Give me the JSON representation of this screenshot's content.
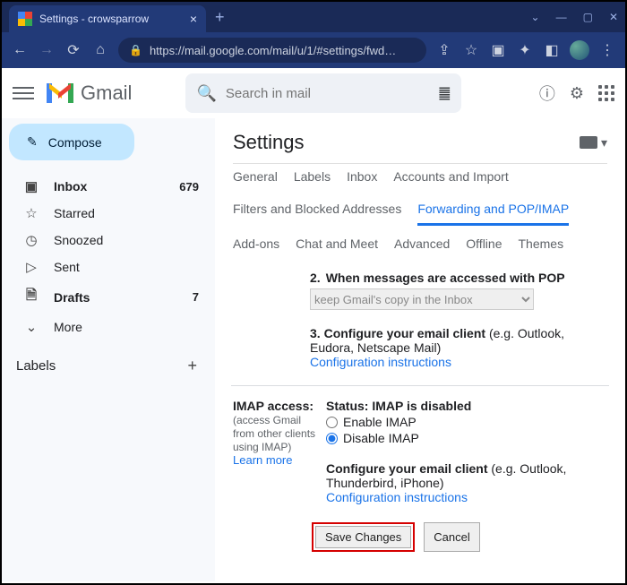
{
  "browser": {
    "tab_title": "Settings - crowsparrow",
    "url_display": "https://mail.google.com/mail/u/1/#settings/fwd…"
  },
  "brand": "Gmail",
  "search": {
    "placeholder": "Search in mail"
  },
  "compose_label": "Compose",
  "nav": {
    "inbox": "Inbox",
    "inbox_count": "679",
    "starred": "Starred",
    "snoozed": "Snoozed",
    "sent": "Sent",
    "drafts": "Drafts",
    "drafts_count": "7",
    "more": "More"
  },
  "labels_header": "Labels",
  "settings": {
    "title": "Settings",
    "tabs": {
      "general": "General",
      "labels": "Labels",
      "inbox": "Inbox",
      "accounts": "Accounts and Import",
      "filters": "Filters and Blocked Addresses",
      "fwd": "Forwarding and POP/IMAP",
      "addons": "Add-ons",
      "chat": "Chat and Meet",
      "advanced": "Advanced",
      "offline": "Offline",
      "themes": "Themes"
    },
    "pop": {
      "step2_num": "2.",
      "step2_label": "When messages are accessed with POP",
      "step2_select": "keep Gmail's copy in the Inbox",
      "step3_num": "3.",
      "step3_bold": "Configure your email client",
      "step3_rest": " (e.g. Outlook, Eudora, Netscape Mail)",
      "config_link": "Configuration instructions"
    },
    "imap": {
      "heading": "IMAP access:",
      "sub": "(access Gmail from other clients using IMAP)",
      "learn": "Learn more",
      "status": "Status: IMAP is disabled",
      "enable": "Enable IMAP",
      "disable": "Disable IMAP",
      "cfg_bold": "Configure your email client",
      "cfg_rest": " (e.g. Outlook, Thunderbird, iPhone)",
      "cfg_link": "Configuration instructions"
    },
    "save": "Save Changes",
    "cancel": "Cancel"
  }
}
